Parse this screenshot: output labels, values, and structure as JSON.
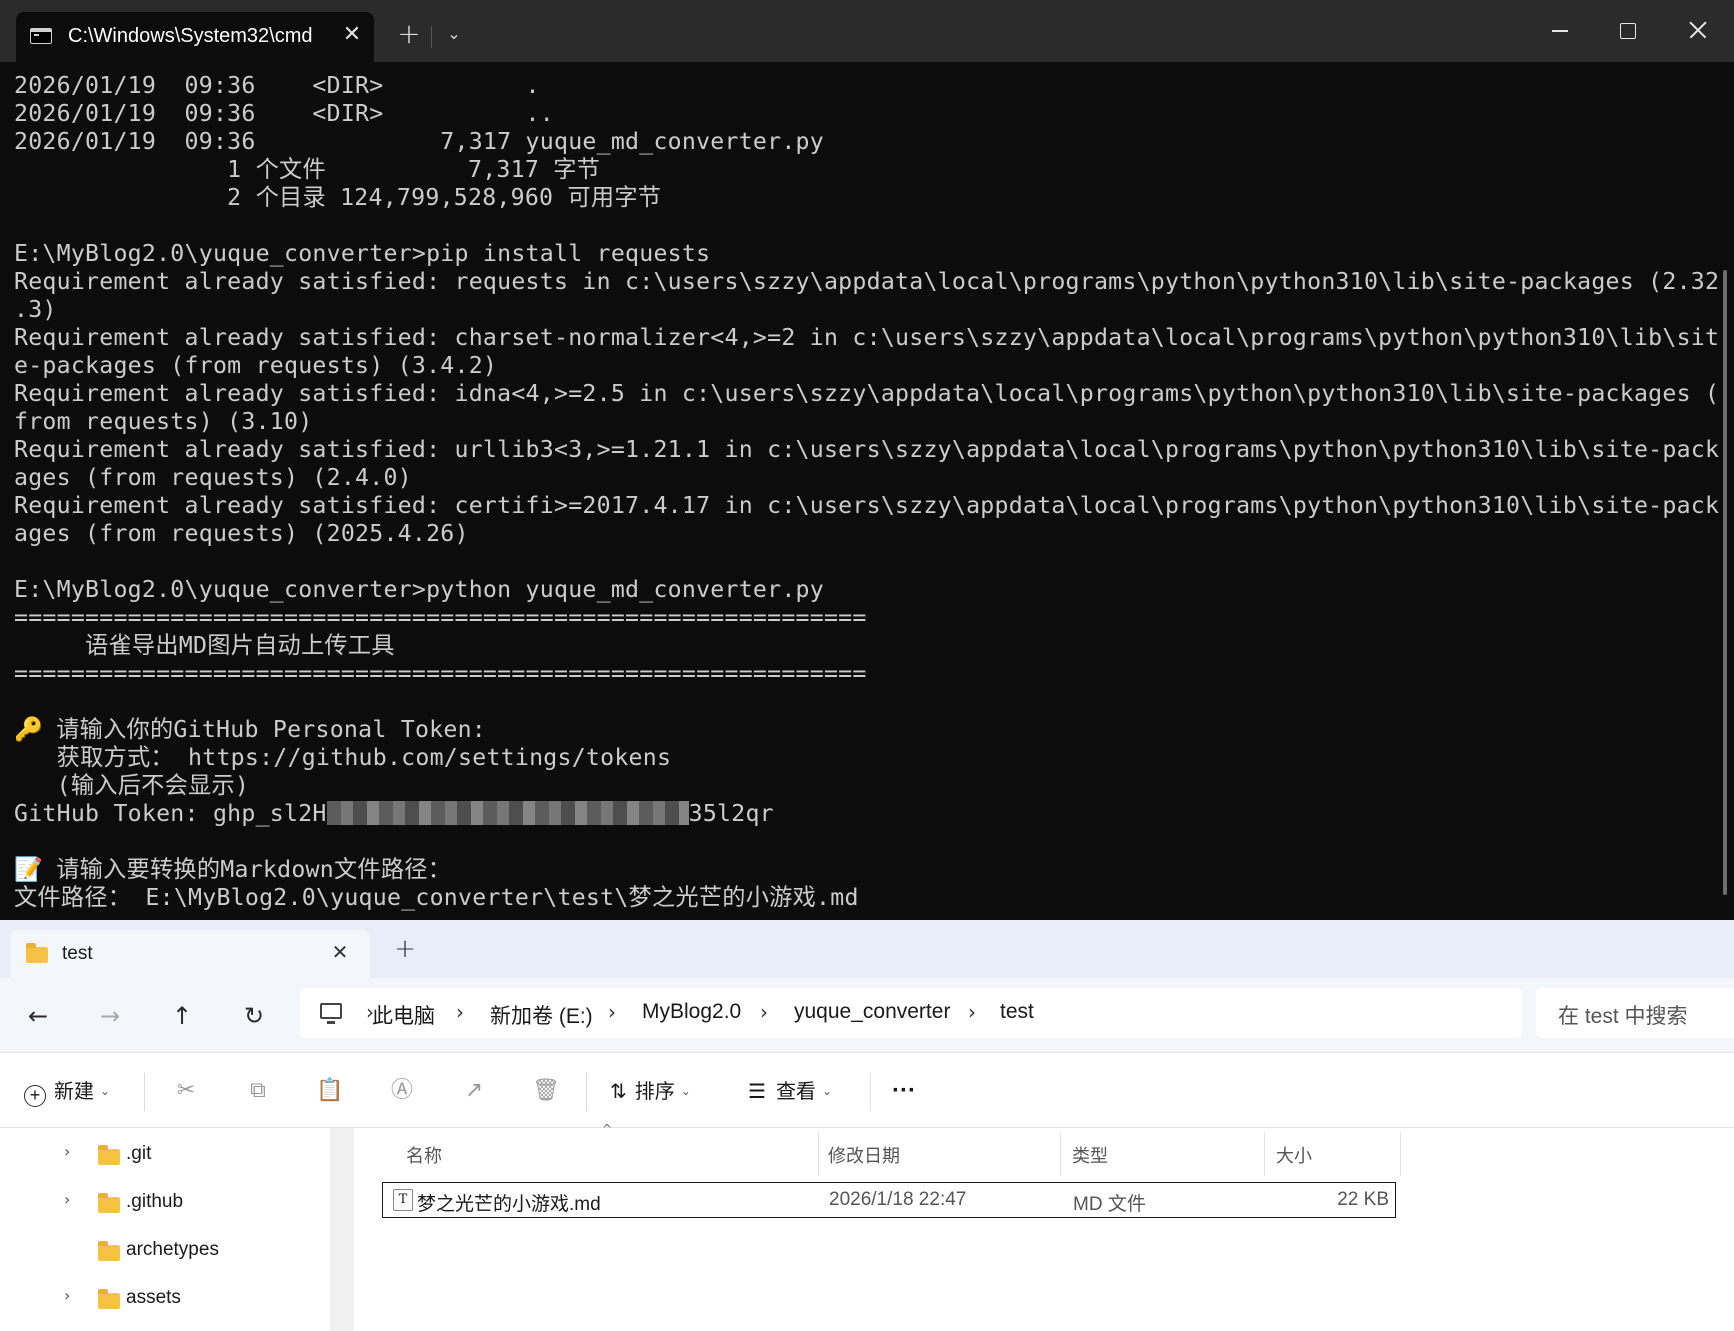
{
  "terminal": {
    "tab_title": "C:\\Windows\\System32\\cmd",
    "lines": [
      "2026/01/19  09:36    <DIR>          .",
      "2026/01/19  09:36    <DIR>          ..",
      "2026/01/19  09:36             7,317 yuque_md_converter.py",
      "               1 个文件          7,317 字节",
      "               2 个目录 124,799,528,960 可用字节",
      "",
      "E:\\MyBlog2.0\\yuque_converter>pip install requests",
      "Requirement already satisfied: requests in c:\\users\\szzy\\appdata\\local\\programs\\python\\python310\\lib\\site-packages (2.32",
      ".3)",
      "Requirement already satisfied: charset-normalizer<4,>=2 in c:\\users\\szzy\\appdata\\local\\programs\\python\\python310\\lib\\sit",
      "e-packages (from requests) (3.4.2)",
      "Requirement already satisfied: idna<4,>=2.5 in c:\\users\\szzy\\appdata\\local\\programs\\python\\python310\\lib\\site-packages (",
      "from requests) (3.10)",
      "Requirement already satisfied: urllib3<3,>=1.21.1 in c:\\users\\szzy\\appdata\\local\\programs\\python\\python310\\lib\\site-pack",
      "ages (from requests) (2.4.0)",
      "Requirement already satisfied: certifi>=2017.4.17 in c:\\users\\szzy\\appdata\\local\\programs\\python\\python310\\lib\\site-pack",
      "ages (from requests) (2025.4.26)",
      "",
      "E:\\MyBlog2.0\\yuque_converter>python yuque_md_converter.py",
      "============================================================",
      "     语雀导出MD图片自动上传工具",
      "============================================================",
      ""
    ],
    "token_prompt": " 请输入你的GitHub Personal Token:",
    "token_howto": "   获取方式： https://github.com/settings/tokens",
    "token_note": "   (输入后不会显示)",
    "token_prefix": "GitHub Token: ghp_sl2H",
    "token_suffix": "35l2qr",
    "path_prompt": " 请输入要转换的Markdown文件路径：",
    "path_value": "文件路径： E:\\MyBlog2.0\\yuque_converter\\test\\梦之光芒的小游戏.md",
    "key_icon": "key-icon",
    "memo_icon": "memo-icon"
  },
  "explorer": {
    "tab_title": "test",
    "breadcrumb": [
      "此电脑",
      "新加卷 (E:)",
      "MyBlog2.0",
      "yuque_converter",
      "test"
    ],
    "search_placeholder": "在 test 中搜索",
    "toolbar": {
      "new_label": "新建",
      "sort_label": "排序",
      "view_label": "查看"
    },
    "tree": [
      {
        "label": ".git",
        "expandable": true
      },
      {
        "label": ".github",
        "expandable": true
      },
      {
        "label": "archetypes",
        "expandable": false
      },
      {
        "label": "assets",
        "expandable": true
      }
    ],
    "columns": {
      "name": "名称",
      "modified": "修改日期",
      "type": "类型",
      "size": "大小"
    },
    "files": [
      {
        "name": "梦之光芒的小游戏.md",
        "modified": "2026/1/18 22:47",
        "type": "MD 文件",
        "size": "22 KB"
      }
    ]
  },
  "colors": {
    "terminal_bg": "#0c0c0c",
    "terminal_fg": "#cccccc",
    "folder": "#f6c243",
    "explorer_chrome": "#f3f6fb"
  }
}
